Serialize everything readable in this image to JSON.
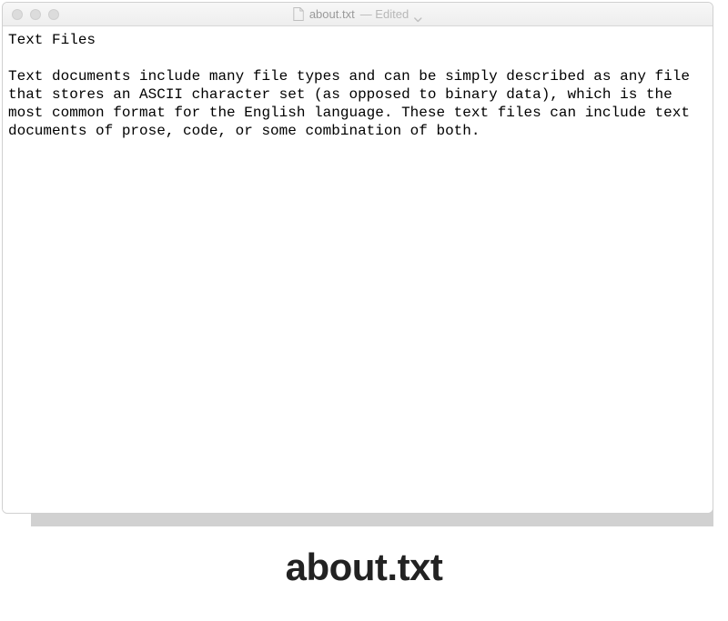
{
  "titlebar": {
    "filename": "about.txt",
    "edited_label": "— Edited"
  },
  "document": {
    "heading": "Text Files",
    "body": "Text documents include many file types and can be simply described as any file that stores an ASCII character set (as opposed to binary data), which is the most common format for the English language. These text files can include text documents of prose, code, or some combination of both."
  },
  "caption": "about.txt"
}
